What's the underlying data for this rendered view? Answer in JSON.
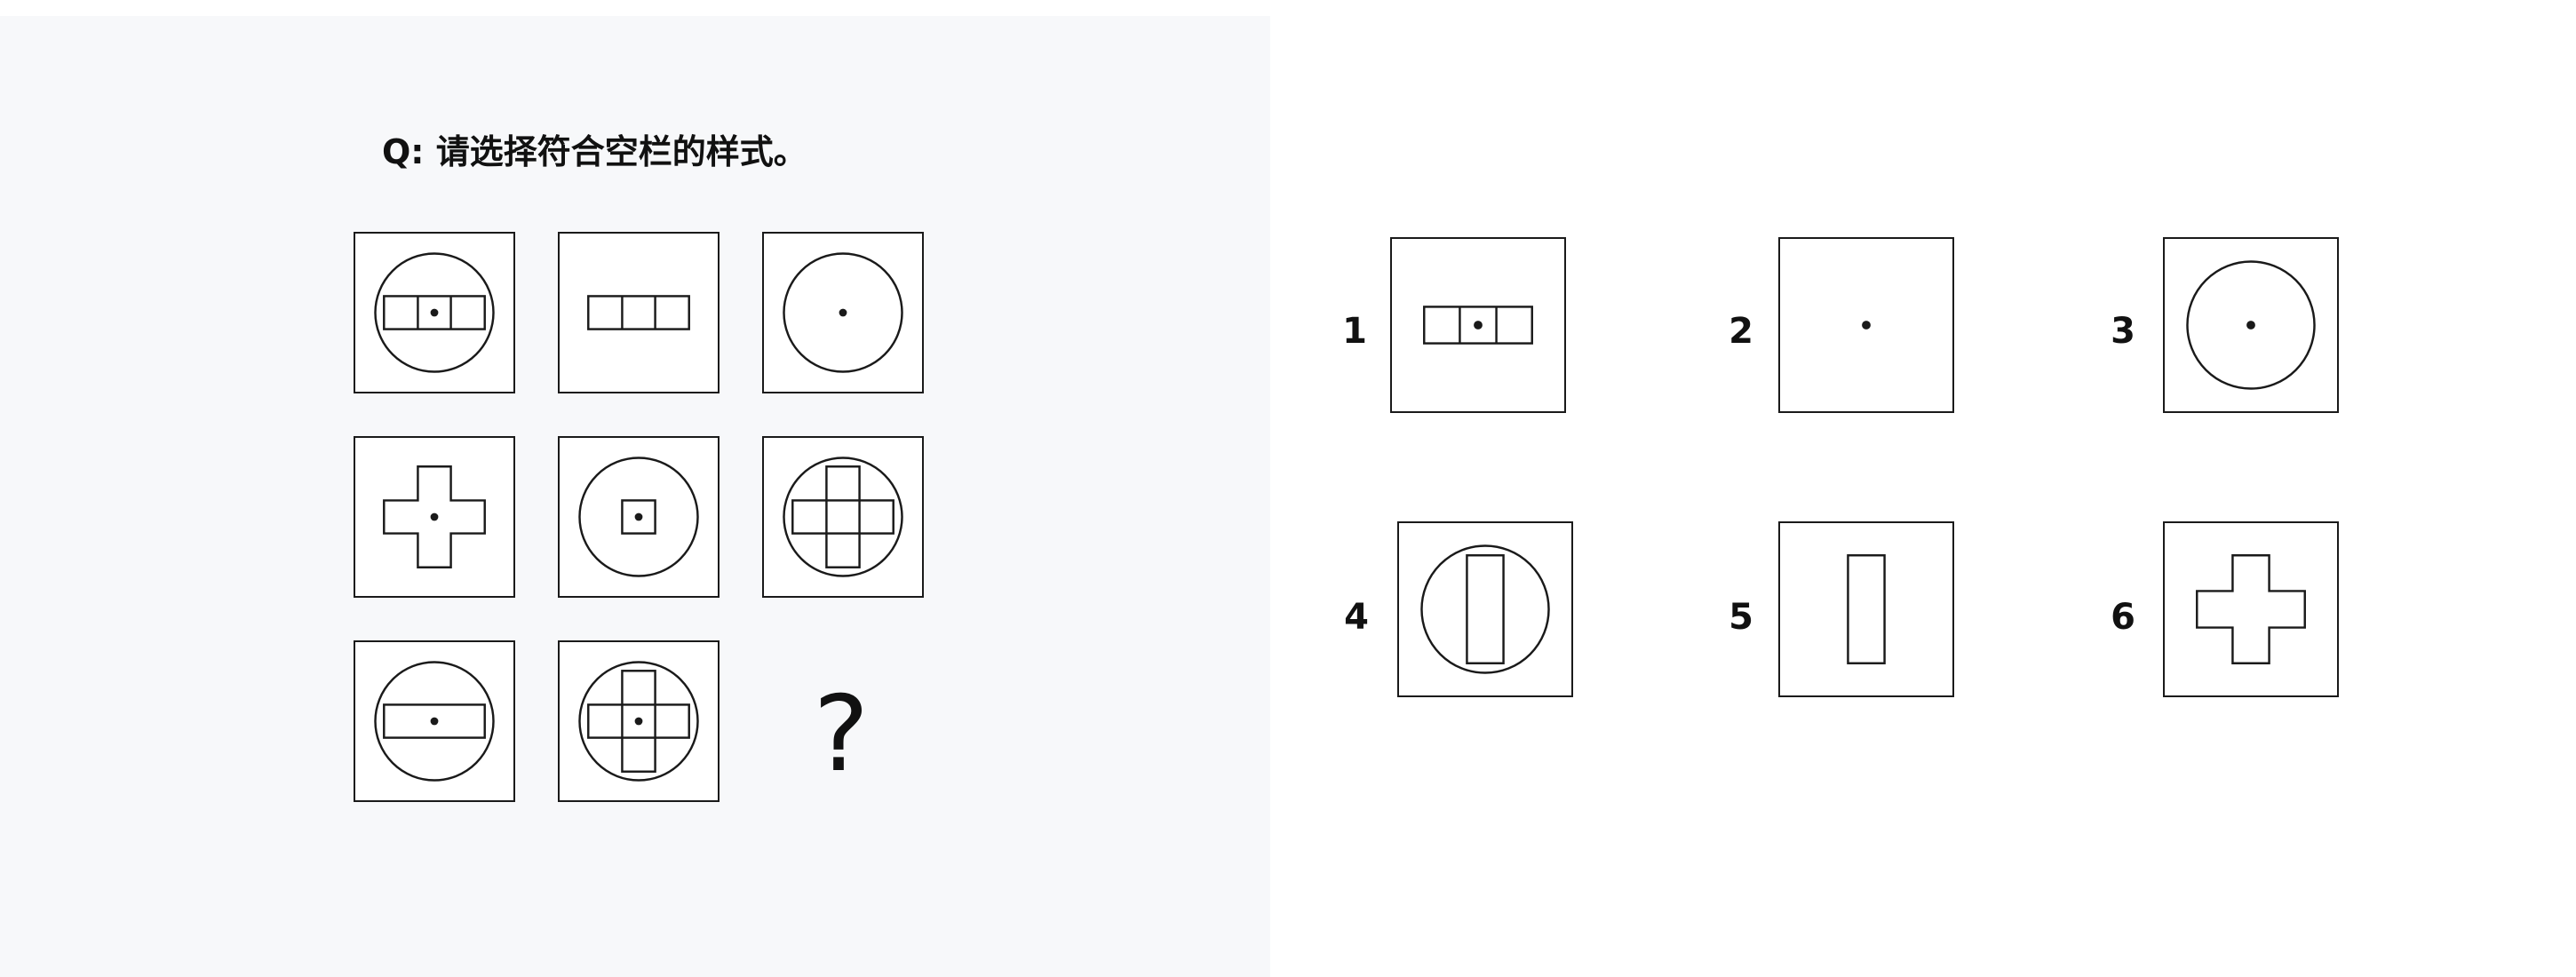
{
  "question": {
    "text": "Q: 请选择符合空栏的样式。"
  },
  "grid": {
    "cells": [
      {
        "row": 1,
        "col": 1,
        "figure": "circle with three-cell horizontal bar and center dot"
      },
      {
        "row": 1,
        "col": 2,
        "figure": "three-cell horizontal bar"
      },
      {
        "row": 1,
        "col": 3,
        "figure": "circle with center dot"
      },
      {
        "row": 2,
        "col": 1,
        "figure": "cross with center dot"
      },
      {
        "row": 2,
        "col": 2,
        "figure": "circle with small square and center dot"
      },
      {
        "row": 2,
        "col": 3,
        "figure": "circle with cross"
      },
      {
        "row": 3,
        "col": 1,
        "figure": "circle with horizontal rectangle and center dot"
      },
      {
        "row": 3,
        "col": 2,
        "figure": "circle with cross and center dot"
      }
    ],
    "missing_mark": "?"
  },
  "options": [
    {
      "label": "1",
      "figure": "three-cell horizontal bar with center dot"
    },
    {
      "label": "2",
      "figure": "center dot"
    },
    {
      "label": "3",
      "figure": "circle with center dot"
    },
    {
      "label": "4",
      "figure": "circle with vertical rectangle"
    },
    {
      "label": "5",
      "figure": "vertical rectangle"
    },
    {
      "label": "6",
      "figure": "cross"
    }
  ]
}
